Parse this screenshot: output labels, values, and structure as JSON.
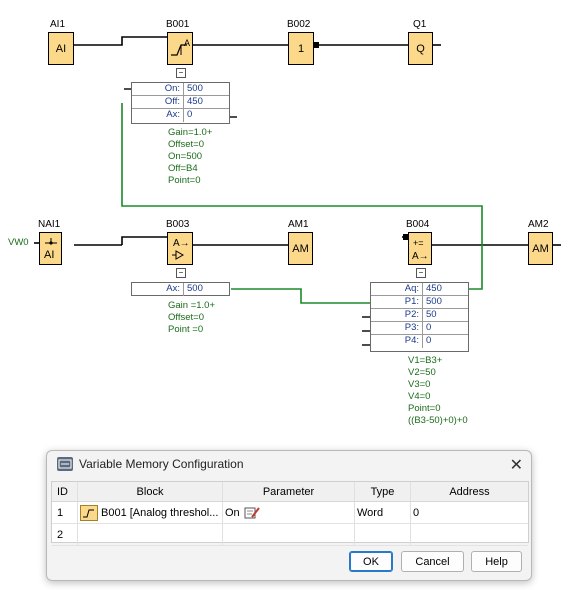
{
  "diagram": {
    "labels": {
      "ai1": "AI1",
      "b001": "B001",
      "b002": "B002",
      "q1": "Q1",
      "nai1": "NAI1",
      "b003": "B003",
      "am1": "AM1",
      "b004": "B004",
      "am2": "AM2",
      "vw0": "VW0"
    },
    "blocks": {
      "ai1": "AI",
      "b002": "1",
      "q1": "Q",
      "nai1": "AI",
      "am1": "AM",
      "am2": "AM"
    },
    "b001_table": {
      "rows": [
        {
          "key": "On:",
          "value": "500"
        },
        {
          "key": "Off:",
          "value": "450"
        },
        {
          "key": "Ax:",
          "value": "0"
        }
      ],
      "params": [
        "Gain=1.0+",
        "Offset=0",
        "On=500",
        "Off=B4",
        "Point=0"
      ]
    },
    "b003_table": {
      "rows": [
        {
          "key": "Ax:",
          "value": "500"
        }
      ],
      "params": [
        "Gain =1.0+",
        "Offset=0",
        "Point =0"
      ]
    },
    "b004_table": {
      "rows": [
        {
          "key": "Aq:",
          "value": "450"
        },
        {
          "key": "P1:",
          "value": "500"
        },
        {
          "key": "P2:",
          "value": "50"
        },
        {
          "key": "P3:",
          "value": "0"
        },
        {
          "key": "P4:",
          "value": "0"
        }
      ],
      "params": [
        "V1=B3+",
        "V2=50",
        "V3=0",
        "V4=0",
        "Point=0",
        "((B3-50)+0)+0"
      ]
    }
  },
  "dialog": {
    "title": "Variable Memory Configuration",
    "columns": {
      "id": "ID",
      "block": "Block",
      "parameter": "Parameter",
      "type": "Type",
      "address": "Address"
    },
    "rows": [
      {
        "id": "1",
        "block": "B001 [Analog threshol...",
        "parameter": "On",
        "type": "Word",
        "address": "0"
      },
      {
        "id": "2",
        "block": "",
        "parameter": "",
        "type": "",
        "address": ""
      }
    ],
    "buttons": {
      "ok": "OK",
      "cancel": "Cancel",
      "help": "Help"
    }
  },
  "colors": {
    "block_fill": "#fcd98a",
    "wire_green": "#1a8a2a",
    "param_text": "#1a6b1a"
  }
}
